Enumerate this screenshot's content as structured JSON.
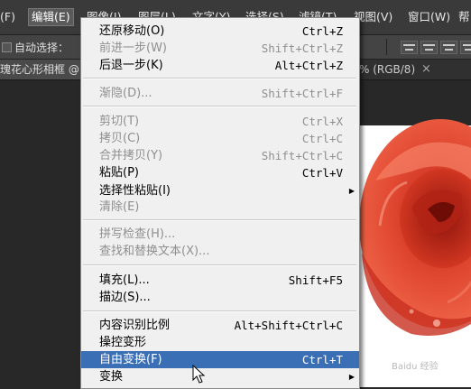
{
  "menubar": {
    "items": [
      {
        "label": "(F)"
      },
      {
        "label": "编辑(E)"
      },
      {
        "label": "图像(I)"
      },
      {
        "label": "图层(L)"
      },
      {
        "label": "文字(Y)"
      },
      {
        "label": "选择(S)"
      },
      {
        "label": "滤镜(T)"
      },
      {
        "label": "视图(V)"
      },
      {
        "label": "窗口(W)"
      },
      {
        "label": "帮"
      }
    ]
  },
  "options": {
    "auto_select_label": "自动选择："
  },
  "tabs": {
    "doc_tab": "瑰花心形相框 @",
    "right_text": "% (RGB/8)",
    "close_symbol": "×"
  },
  "menu": {
    "items": [
      {
        "label": "还原移动(O)",
        "shortcut": "Ctrl+Z",
        "enabled": true
      },
      {
        "label": "前进一步(W)",
        "shortcut": "Shift+Ctrl+Z",
        "enabled": false
      },
      {
        "label": "后退一步(K)",
        "shortcut": "Alt+Ctrl+Z",
        "enabled": true
      },
      {
        "label": "渐隐(D)...",
        "shortcut": "Shift+Ctrl+F",
        "enabled": false
      },
      {
        "label": "剪切(T)",
        "shortcut": "Ctrl+X",
        "enabled": false
      },
      {
        "label": "拷贝(C)",
        "shortcut": "Ctrl+C",
        "enabled": false
      },
      {
        "label": "合并拷贝(Y)",
        "shortcut": "Shift+Ctrl+C",
        "enabled": false
      },
      {
        "label": "粘贴(P)",
        "shortcut": "Ctrl+V",
        "enabled": true
      },
      {
        "label": "选择性粘贴(I)",
        "shortcut": "",
        "enabled": true,
        "submenu": true
      },
      {
        "label": "清除(E)",
        "shortcut": "",
        "enabled": false
      },
      {
        "label": "拼写检查(H)...",
        "shortcut": "",
        "enabled": false
      },
      {
        "label": "查找和替换文本(X)...",
        "shortcut": "",
        "enabled": false
      },
      {
        "label": "填充(L)...",
        "shortcut": "Shift+F5",
        "enabled": true
      },
      {
        "label": "描边(S)...",
        "shortcut": "",
        "enabled": true
      },
      {
        "label": "内容识别比例",
        "shortcut": "Alt+Shift+Ctrl+C",
        "enabled": true
      },
      {
        "label": "操控变形",
        "shortcut": "",
        "enabled": true
      },
      {
        "label": "自由变换(F)",
        "shortcut": "Ctrl+T",
        "enabled": true,
        "highlighted": true
      },
      {
        "label": "变换",
        "shortcut": "",
        "enabled": true,
        "submenu": true
      }
    ],
    "submenu_arrow": "▶"
  },
  "watermark": "Baidu 经验",
  "colors": {
    "highlight": "#3a6fb6",
    "menu_bg": "#f0f0f0",
    "app_bg": "#282828"
  }
}
